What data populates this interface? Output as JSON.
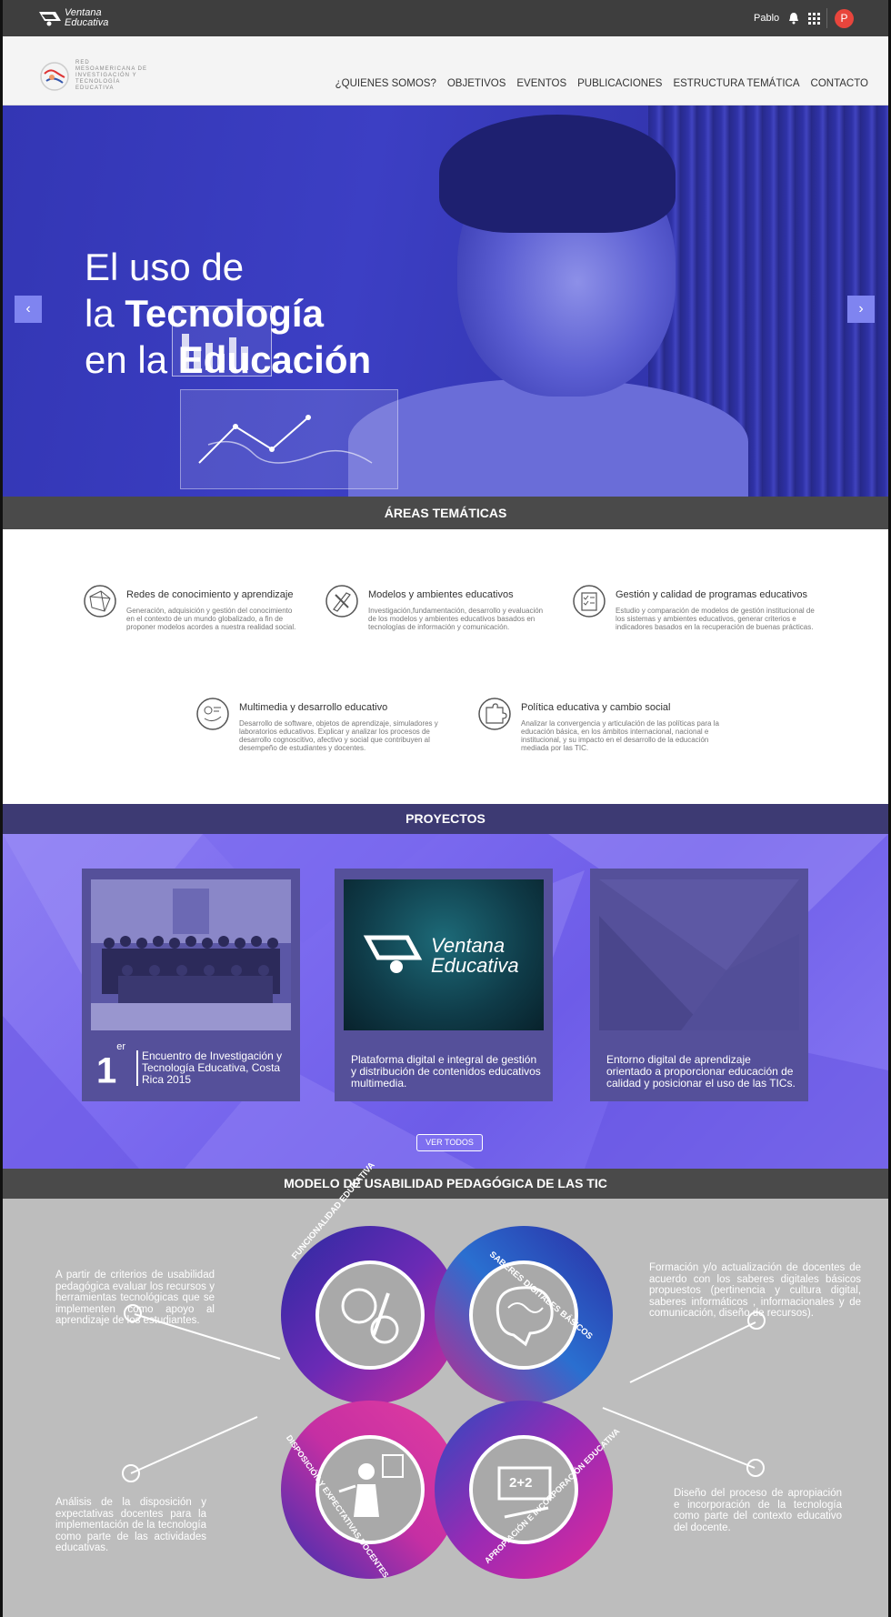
{
  "topbar": {
    "logo_text_line1": "Ventana",
    "logo_text_line2": "Educativa",
    "user_name": "Pablo",
    "avatar_initial": "P",
    "avatar_color": "#e8453c"
  },
  "nav": {
    "logo_text": "RED MESOAMERICANA DE INVESTIGACIÓN Y TECNOLOGÍA EDUCATIVA",
    "items": [
      "¿QUIENES SOMOS?",
      "OBJETIVOS",
      "EVENTOS",
      "PUBLICACIONES",
      "ESTRUCTURA TEMÁTICA",
      "CONTACTO"
    ]
  },
  "hero": {
    "line1": "El uso de",
    "line2_a": "la ",
    "line2_b": "Tecnología",
    "line3_a": "en la ",
    "line3_b": "Educación",
    "prev": "‹",
    "next": "›"
  },
  "areas": {
    "heading": "ÁREAS TEMÁTICAS",
    "items": [
      {
        "title": "Redes de conocimiento y aprendizaje",
        "desc": "Generación, adquisición y gestión del conocimiento en el contexto de un mundo globalizado, a fin de proponer modelos acordes a nuestra realidad social."
      },
      {
        "title": "Modelos y ambientes educativos",
        "desc": "Investigación,fundamentación, desarrollo y evaluación de los modelos y ambientes educativos basados en tecnologías de información y comunicación."
      },
      {
        "title": "Gestión y calidad de programas educativos",
        "desc": "Estudio y comparación de modelos de gestión institucional de los sistemas y ambientes educativos, generar criterios e indicadores basados en la recuperación de buenas prácticas."
      },
      {
        "title": "Multimedia y desarrollo educativo",
        "desc": "Desarrollo de software, objetos de aprendizaje, simuladores y laboratorios educativos. Explicar y analizar los procesos de desarrollo cognoscitivo, afectivo y social que contribuyen al desempeño de estudiantes y  docentes."
      },
      {
        "title": "Política educativa y cambio social",
        "desc": "Analizar la convergencia y articulación de las políticas para la educación básica, en los ámbitos internacional, nacional e institucional, y su impacto en el desarrollo de la educación mediada por las TIC."
      }
    ]
  },
  "proyectos": {
    "heading": "PROYECTOS",
    "card1_num": "1",
    "card1_sup": "er",
    "card1_text": "Encuentro de Investigación y Tecnología Educativa, Costa Rica 2015",
    "card2_logo_line1": "Ventana",
    "card2_logo_line2": "Educativa",
    "card2_text": "Plataforma digital e integral de gestión y distribución de contenidos educativos multimedia.",
    "card3_text": "Entorno digital de aprendizaje orientado a proporcionar educación de calidad y posicionar el uso de las TICs.",
    "button": "VER TODOS"
  },
  "modelo": {
    "heading": "MODELO DE USABILIDAD PEDAGÓGICA DE LAS TIC",
    "text_top_left": "A partir de criterios de usabilidad pedagógica evaluar los recursos y herramientas tecnológicas que se implementen como apoyo al aprendizaje de los estudiantes.",
    "text_top_right": "Formación y/o actualización de docentes de acuerdo con los saberes digitales básicos propuestos (pertinencia y cultura digital, saberes informáticos , informacionales y de comunicación, diseño de recursos).",
    "text_bottom_left": "Análisis de la disposición y expectativas docentes para la implementación de la tecnología como parte de las actividades educativas.",
    "text_bottom_right": "Diseño del proceso de apropiación e incorporación de la tecnología como parte del contexto educativo del docente.",
    "labels": [
      "FUNCIONALIDAD EDUCATIVA",
      "SABERES DIGITALES BÁSICOS",
      "DISPOSICIÓN Y EXPECTATIVAS DOCENTES",
      "APROPIACIÓN E INCORPORACIÓN EDUCATIVA"
    ],
    "chalk_text": "2+2"
  },
  "colors": {
    "topbar": "#3e3e3e",
    "hero": "#3c3fc4",
    "proyectos": "#7d6cf0",
    "section_header": "#4a4a4a",
    "proyectos_header": "#3d3a73",
    "modelo_bg": "#bdbdbd"
  }
}
